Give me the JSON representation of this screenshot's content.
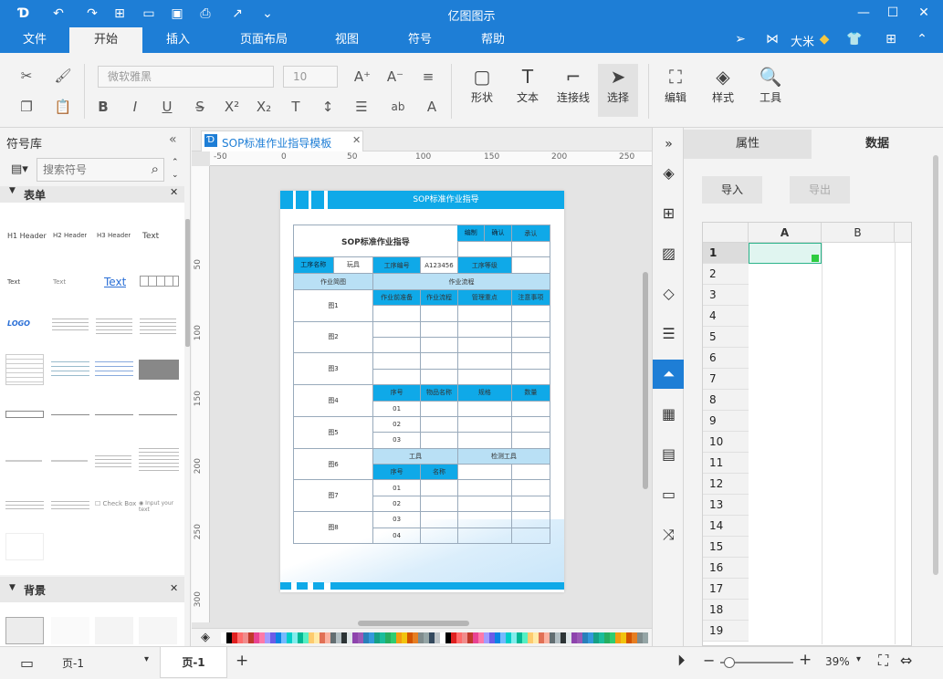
{
  "app": {
    "title": "亿图图示"
  },
  "menu": {
    "tabs": [
      "文件",
      "开始",
      "插入",
      "页面布局",
      "视图",
      "符号",
      "帮助"
    ],
    "user": "大米"
  },
  "toolbar": {
    "font_family": "微软雅黑",
    "font_size": "10",
    "shape": "形状",
    "text": "文本",
    "connector": "连接线",
    "select": "选择",
    "edit": "编辑",
    "style": "样式",
    "tools": "工具"
  },
  "left_panel": {
    "title": "符号库",
    "search_placeholder": "搜索符号",
    "section_form": "表单",
    "section_bg": "背景",
    "items": {
      "h1": "H1 Header",
      "h2": "H2 Header",
      "h3": "H3 Header",
      "text1": "Text",
      "text2": "Text",
      "text3": "Text",
      "text_link": "Text",
      "logo": "LOGO",
      "checkbox": "Check Box",
      "radio": "Input your text"
    }
  },
  "doc": {
    "tab": "SOP标准作业指导模板",
    "ruler_h": [
      "-50",
      "0",
      "50",
      "100",
      "150",
      "200",
      "250"
    ],
    "ruler_v": [
      "50",
      "100",
      "150",
      "200",
      "250",
      "300"
    ]
  },
  "sop": {
    "banner": "SOP标准作业指导",
    "title": "SOP标准作业指导",
    "make": "编制",
    "confirm": "确认",
    "approve": "承认",
    "process_name": "工序名称",
    "process_val": "玩具",
    "process_no": "工序编号",
    "process_no_val": "A123456",
    "process_level": "工序等级",
    "diagram": "作业简图",
    "flow": "作业流程",
    "prep": "作业前准备",
    "flow2": "作业流程",
    "key": "管理重点",
    "note": "注意事项",
    "figs": [
      "图1",
      "图2",
      "图3",
      "图4",
      "图5",
      "图6",
      "图7",
      "图8"
    ],
    "no": "序号",
    "item_name": "物品名称",
    "spec": "规格",
    "qty": "数量",
    "rows1": [
      "01",
      "02",
      "03"
    ],
    "tools": "工具",
    "inspect": "检测工具",
    "no2": "序号",
    "name2": "名称",
    "rows2": [
      "01",
      "02",
      "03",
      "04"
    ]
  },
  "right_panel": {
    "tab_props": "属性",
    "tab_data": "数据",
    "import": "导入",
    "export": "导出",
    "cols": [
      "A",
      "B"
    ],
    "rows": [
      "1",
      "2",
      "3",
      "4",
      "5",
      "6",
      "7",
      "8",
      "9",
      "10",
      "11",
      "12",
      "13",
      "14",
      "15",
      "16",
      "17",
      "18",
      "19"
    ]
  },
  "status": {
    "page_dd": "页-1",
    "page_tab": "页-1",
    "zoom": "39%"
  },
  "colors": {
    "brand": "#1e7ed6",
    "accent": "#0fa9e8"
  }
}
